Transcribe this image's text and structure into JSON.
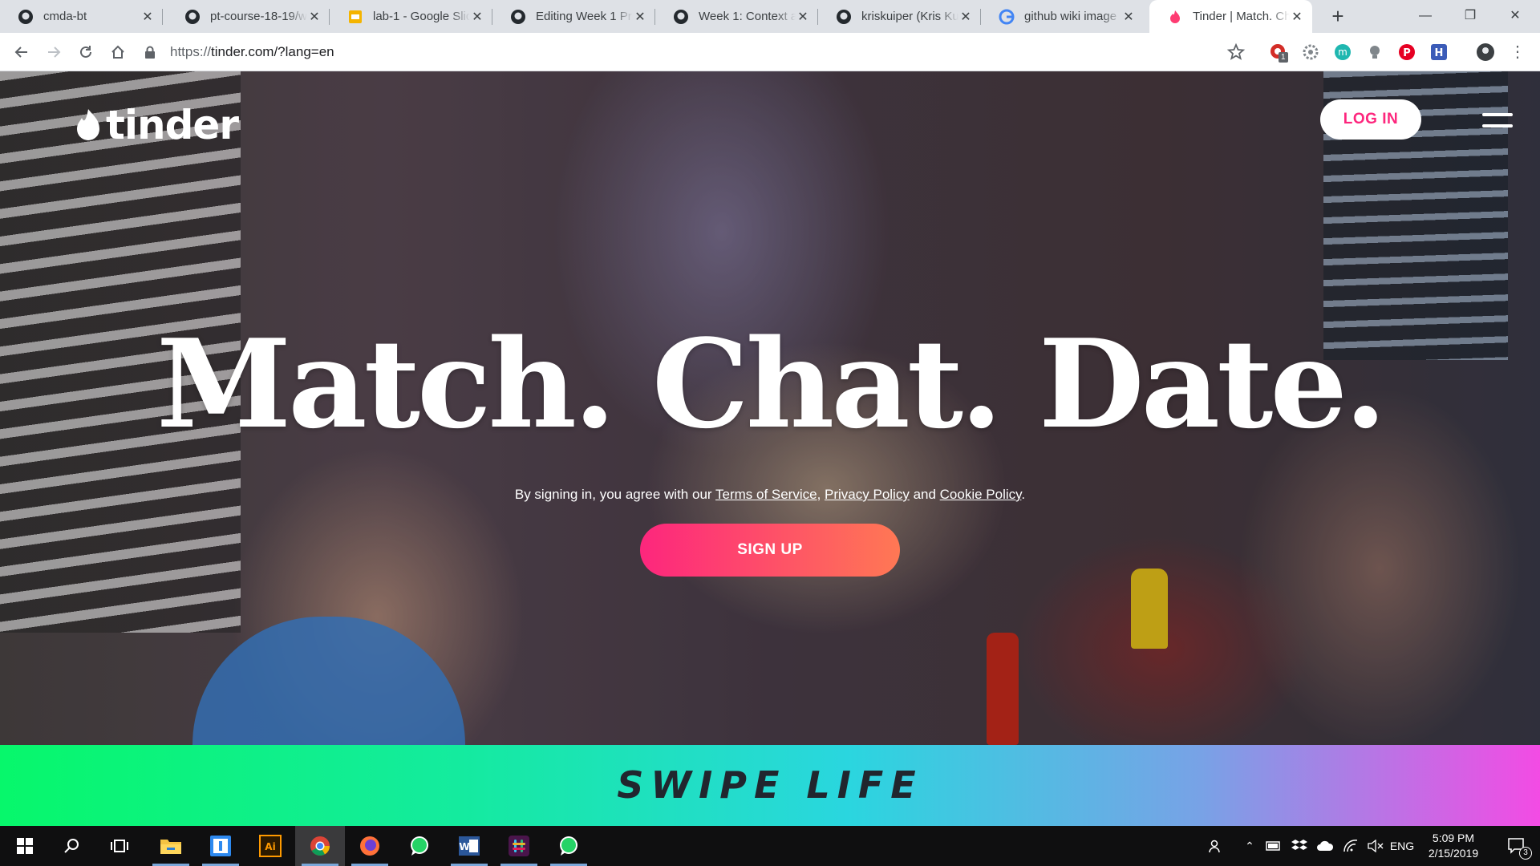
{
  "browser": {
    "tabs": [
      {
        "title": "cmda-bt",
        "icon": "github-icon"
      },
      {
        "title": "pt-course-18-19/w",
        "icon": "github-icon"
      },
      {
        "title": "lab-1 - Google Slid",
        "icon": "google-slides-icon"
      },
      {
        "title": "Editing Week 1 Pro",
        "icon": "github-icon"
      },
      {
        "title": "Week 1: Context ar",
        "icon": "github-icon"
      },
      {
        "title": "kriskuiper (Kris Kui",
        "icon": "github-icon"
      },
      {
        "title": "github wiki image",
        "icon": "google-icon"
      },
      {
        "title": "Tinder | Match. Ch",
        "icon": "tinder-icon",
        "active": true
      }
    ],
    "url_scheme": "https://",
    "url_rest": "tinder.com/?lang=en",
    "extension_badge": "1"
  },
  "page": {
    "logo_text": "tinder",
    "login_label": "LOG IN",
    "headline": "Match. Chat. Date.",
    "legal": {
      "prefix": "By signing in, you agree with our ",
      "terms": "Terms of Service",
      "comma": ", ",
      "privacy": "Privacy Policy",
      "and": " and ",
      "cookie": "Cookie Policy",
      "period": "."
    },
    "signup_label": "SIGN UP",
    "band_text": "SWIPE LIFE"
  },
  "taskbar": {
    "apps": [
      "start-icon",
      "search-icon",
      "task-view-icon",
      "file-explorer-icon",
      "teams-icon",
      "illustrator-icon",
      "chrome-icon",
      "firefox-icon",
      "whatsapp-icon",
      "word-icon",
      "slack-icon",
      "whatsapp-icon"
    ],
    "language": "ENG",
    "time": "5:09 PM",
    "date": "2/15/2019",
    "notification_count": "3"
  },
  "colors": {
    "tinder_pink": "#fd267d",
    "tinder_orange": "#ff7854",
    "band_green": "#07f76b",
    "band_magenta": "#f34be4"
  }
}
